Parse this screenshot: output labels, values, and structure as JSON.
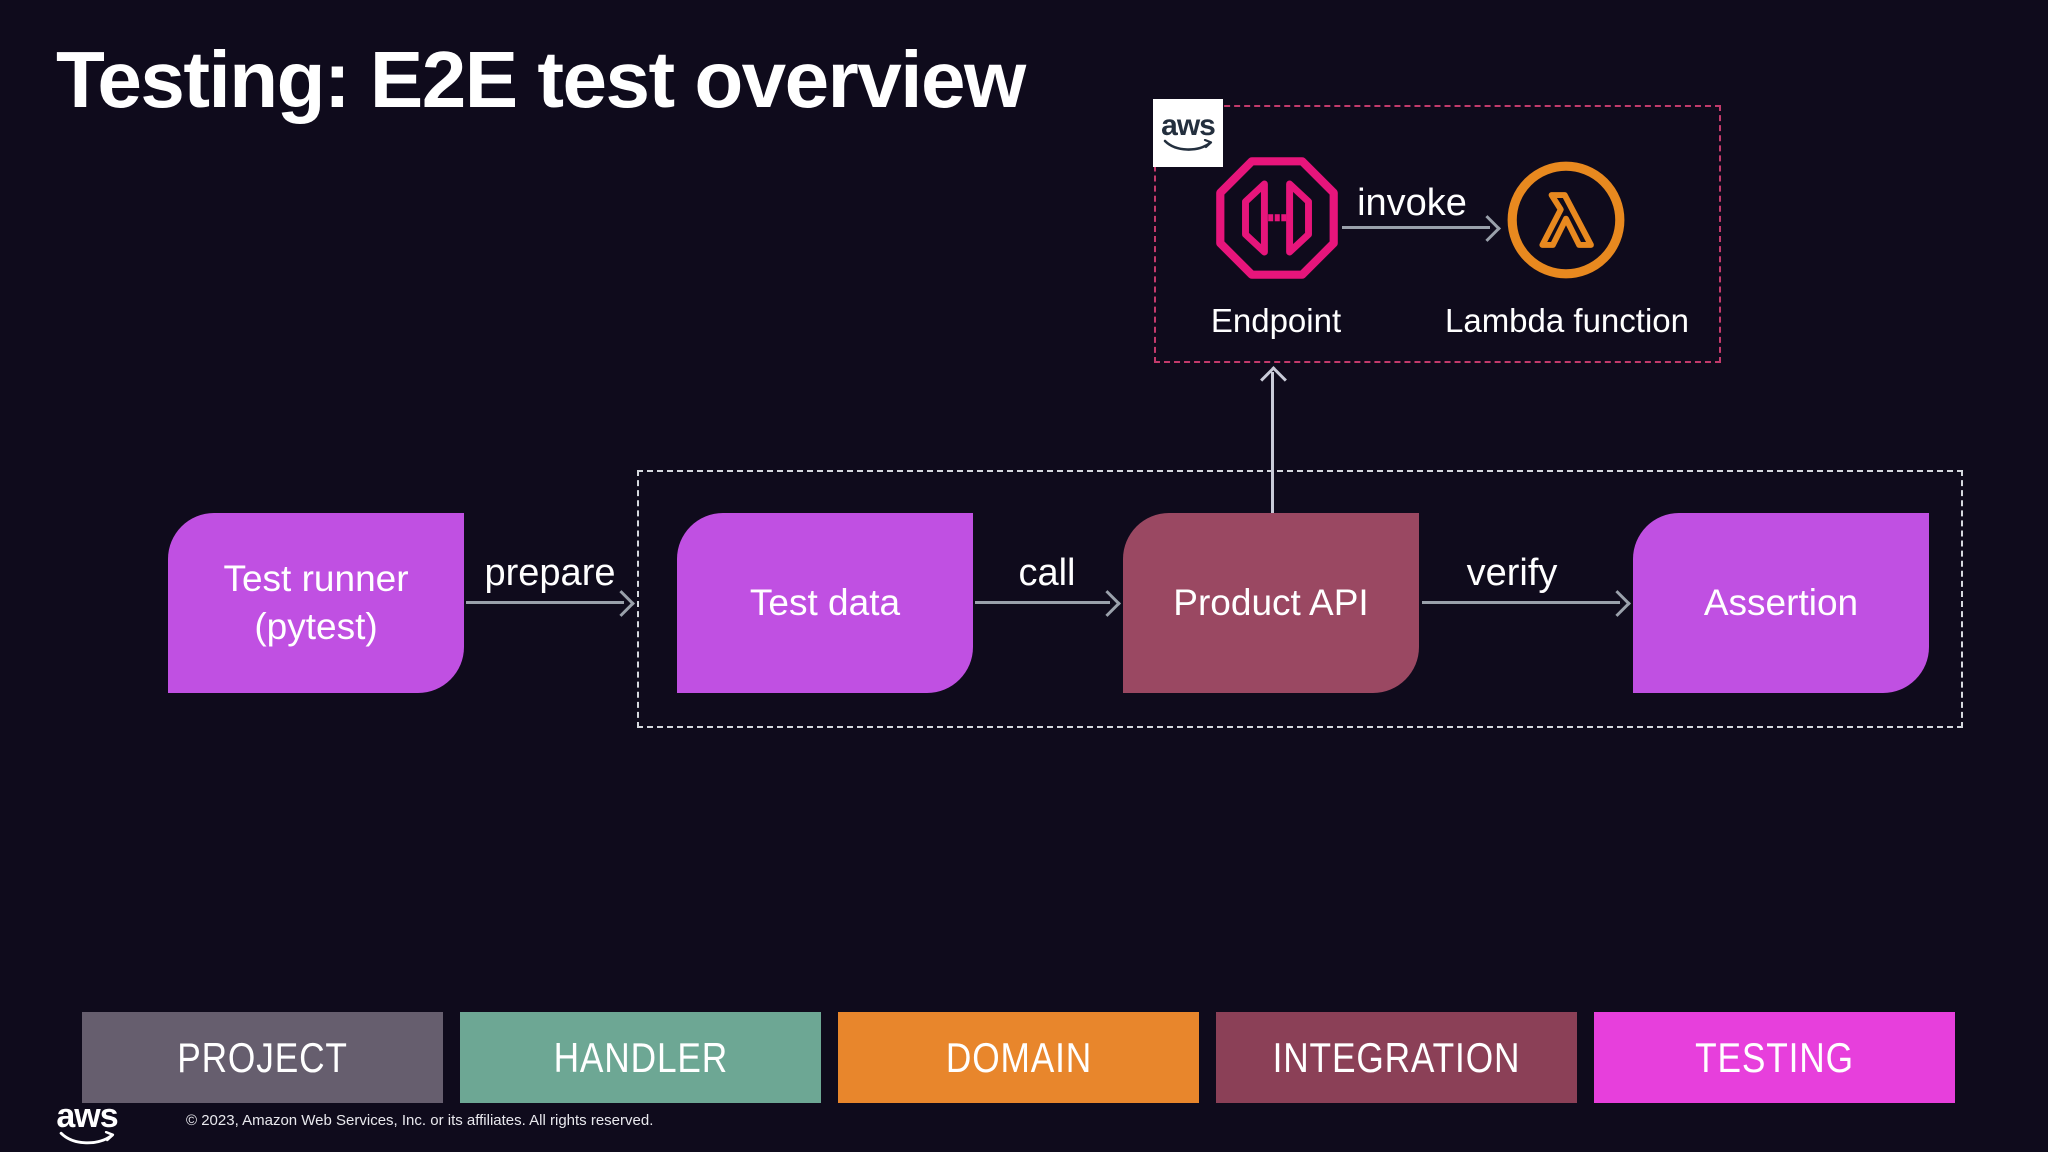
{
  "title": "Testing: E2E test overview",
  "colors": {
    "background": "#0f0b1c",
    "box_magenta": "#c050e2",
    "box_maroon": "#9a4862",
    "endpoint_pink": "#e7157b",
    "lambda_orange": "#e8891f",
    "dashed_pink": "#c23a6b",
    "dashed_white": "#d5d8de",
    "arrow_gray": "#9aa1ab",
    "arrow_light": "#c9cbd8"
  },
  "aws_group": {
    "badge_text": "aws",
    "endpoint_label": "Endpoint",
    "invoke_label": "invoke",
    "lambda_label": "Lambda function"
  },
  "pipeline": {
    "test_runner_line1": "Test runner",
    "test_runner_line2": "(pytest)",
    "prepare_label": "prepare",
    "test_data_label": "Test data",
    "call_label": "call",
    "product_api_label": "Product API",
    "verify_label": "verify",
    "assertion_label": "Assertion"
  },
  "footer": {
    "tabs": [
      {
        "label": "PROJECT",
        "color": "#665e6e"
      },
      {
        "label": "HANDLER",
        "color": "#6da794"
      },
      {
        "label": "DOMAIN",
        "color": "#e8862c"
      },
      {
        "label": "INTEGRATION",
        "color": "#8b4057"
      },
      {
        "label": "TESTING",
        "color": "#e73fdc"
      }
    ],
    "copyright": "© 2023, Amazon Web Services, Inc. or its affiliates. All rights reserved.",
    "logo_text": "aws"
  }
}
